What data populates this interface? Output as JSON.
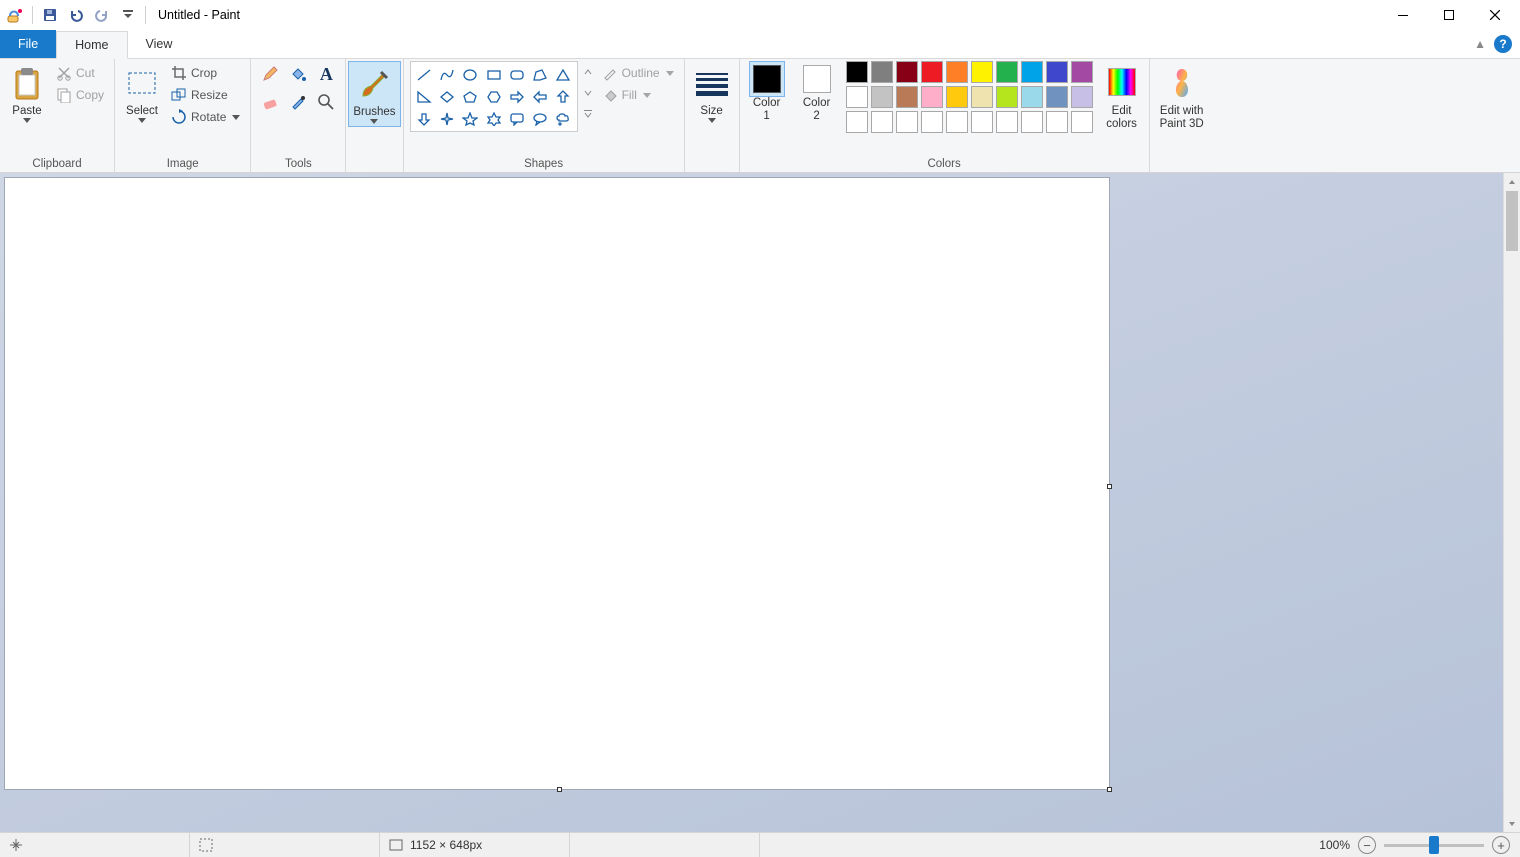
{
  "title": "Untitled - Paint",
  "tabs": {
    "file": "File",
    "home": "Home",
    "view": "View"
  },
  "clipboard": {
    "label": "Clipboard",
    "paste": "Paste",
    "cut": "Cut",
    "copy": "Copy"
  },
  "image": {
    "label": "Image",
    "select": "Select",
    "crop": "Crop",
    "resize": "Resize",
    "rotate": "Rotate"
  },
  "tools": {
    "label": "Tools"
  },
  "brushes": {
    "label": "Brushes"
  },
  "shapes": {
    "label": "Shapes",
    "outline": "Outline",
    "fill": "Fill"
  },
  "size": {
    "label": "Size"
  },
  "colors": {
    "label": "Colors",
    "color1": "Color\n1",
    "color2": "Color\n2",
    "edit": "Edit\ncolors",
    "color1_value": "#000000",
    "color2_value": "#ffffff",
    "palette_row1": [
      "#000000",
      "#7f7f7f",
      "#880015",
      "#ed1c24",
      "#ff7f27",
      "#fff200",
      "#22b14c",
      "#00a2e8",
      "#3f48cc",
      "#a349a4"
    ],
    "palette_row2": [
      "#ffffff",
      "#c3c3c3",
      "#b97a57",
      "#ffaec9",
      "#ffc90e",
      "#efe4b0",
      "#b5e61d",
      "#99d9ea",
      "#7092be",
      "#c8bfe7"
    ],
    "palette_row3": [
      "#ffffff",
      "#ffffff",
      "#ffffff",
      "#ffffff",
      "#ffffff",
      "#ffffff",
      "#ffffff",
      "#ffffff",
      "#ffffff",
      "#ffffff"
    ]
  },
  "paint3d": {
    "label": "Edit with\nPaint 3D"
  },
  "status": {
    "dimensions": "1152 × 648px",
    "zoom": "100%"
  }
}
